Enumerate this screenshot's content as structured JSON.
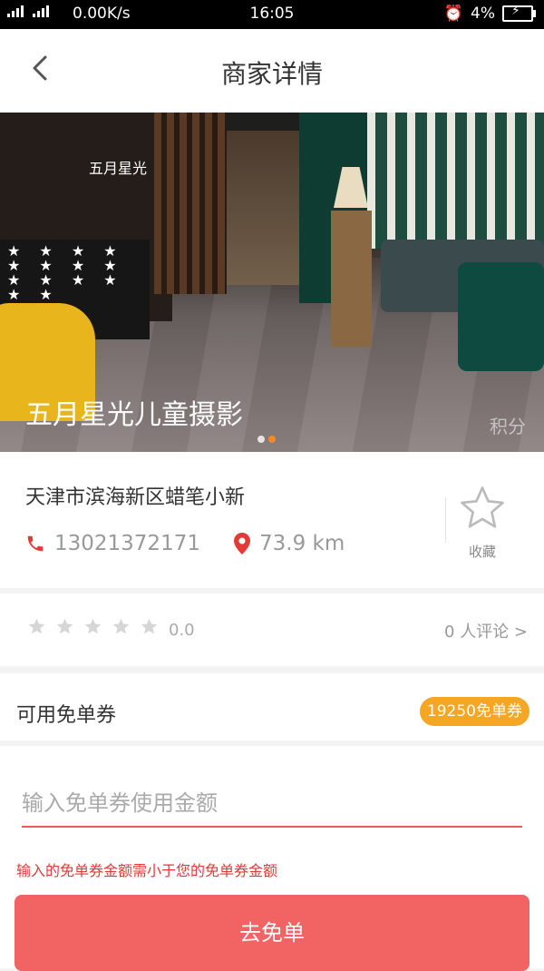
{
  "status_bar": {
    "network": "0.00K/s",
    "time": "16:05",
    "battery": "4%"
  },
  "header": {
    "title": "商家详情"
  },
  "banner": {
    "shop_name": "五月星光儿童摄影",
    "sign_text": "五月星光",
    "watermark": "积分",
    "slide_count": 2,
    "active_slide": 2
  },
  "merchant": {
    "address": "天津市滨海新区蜡笔小新",
    "phone": "13021372171",
    "distance": "73.9 km",
    "favorite_label": "收藏"
  },
  "rating": {
    "stars": 0,
    "max_stars": 5,
    "score": "0.0",
    "reviews": "0 人评论 >"
  },
  "voucher": {
    "label": "可用免单券",
    "badge": "19250免单券"
  },
  "form": {
    "amount_placeholder": "输入免单券使用金额",
    "amount_value": "",
    "error": "输入的免单券金额需小于您的免单券金额",
    "submit_label": "去免单"
  },
  "colors": {
    "accent": "#f26464",
    "error": "#e53935",
    "badge": "#f5a623",
    "icon_red": "#e53935",
    "muted": "#999999"
  }
}
